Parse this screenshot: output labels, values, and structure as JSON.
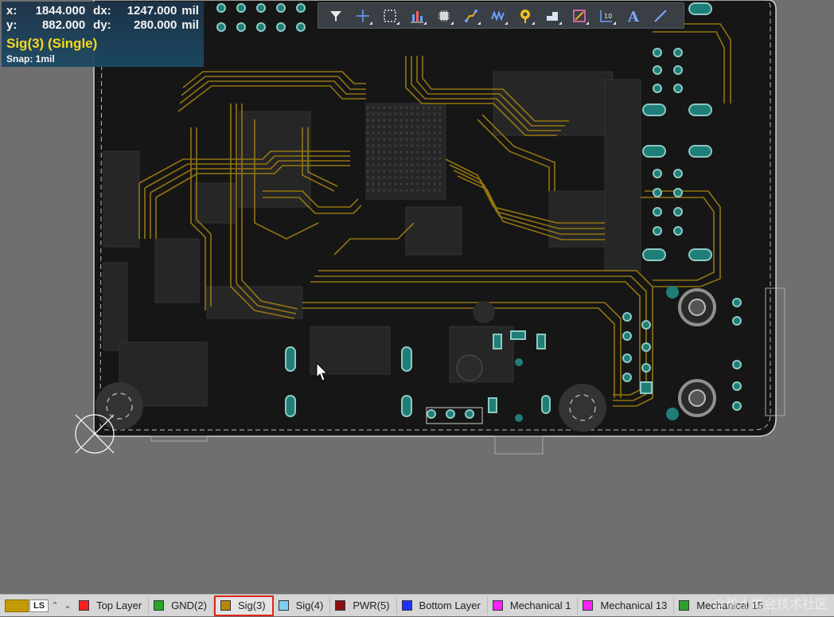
{
  "hud": {
    "x_label": "x:",
    "x_value": "1844.000",
    "dx_label": "dx:",
    "dx_value": "1247.000",
    "dx_unit": "mil",
    "y_label": "y:",
    "y_value": "882.000",
    "dy_label": "dy:",
    "dy_value": "280.000",
    "dy_unit": "mil",
    "layer": "Sig(3) (Single)",
    "snap": "Snap: 1mil"
  },
  "toolbar": {
    "buttons": [
      {
        "icon": "filter-icon"
      },
      {
        "icon": "crosshair-icon"
      },
      {
        "icon": "select-rectangle-icon"
      },
      {
        "icon": "align-icon"
      },
      {
        "icon": "component-icon"
      },
      {
        "icon": "route-icon"
      },
      {
        "icon": "interactive-route-icon"
      },
      {
        "icon": "via-icon"
      },
      {
        "icon": "polygon-icon"
      },
      {
        "icon": "dimension-icon"
      },
      {
        "icon": "string-icon"
      },
      {
        "icon": "text-icon",
        "glyph": "A"
      },
      {
        "icon": "line-icon"
      }
    ]
  },
  "layerbar": {
    "ls_label": "LS",
    "current_color": "#c49a00",
    "tabs": [
      {
        "label": "Top Layer",
        "color": "#ff2020"
      },
      {
        "label": "GND(2)",
        "color": "#2aa52a"
      },
      {
        "label": "Sig(3)",
        "color": "#b8860b",
        "active": true
      },
      {
        "label": "Sig(4)",
        "color": "#7ecff5"
      },
      {
        "label": "PWR(5)",
        "color": "#8b1010"
      },
      {
        "label": "Bottom Layer",
        "color": "#2030ff"
      },
      {
        "label": "Mechanical 1",
        "color": "#ff20ff"
      },
      {
        "label": "Mechanical 13",
        "color": "#ff20ff"
      },
      {
        "label": "Mechanical 15",
        "color": "#2aa52a"
      }
    ],
    "watermark": "@稀土掘金技术社区"
  },
  "colors": {
    "board": "#1a1a1a",
    "trace": "#a8860f",
    "pad": "#2f8f86",
    "background": "#6f6f6f"
  }
}
